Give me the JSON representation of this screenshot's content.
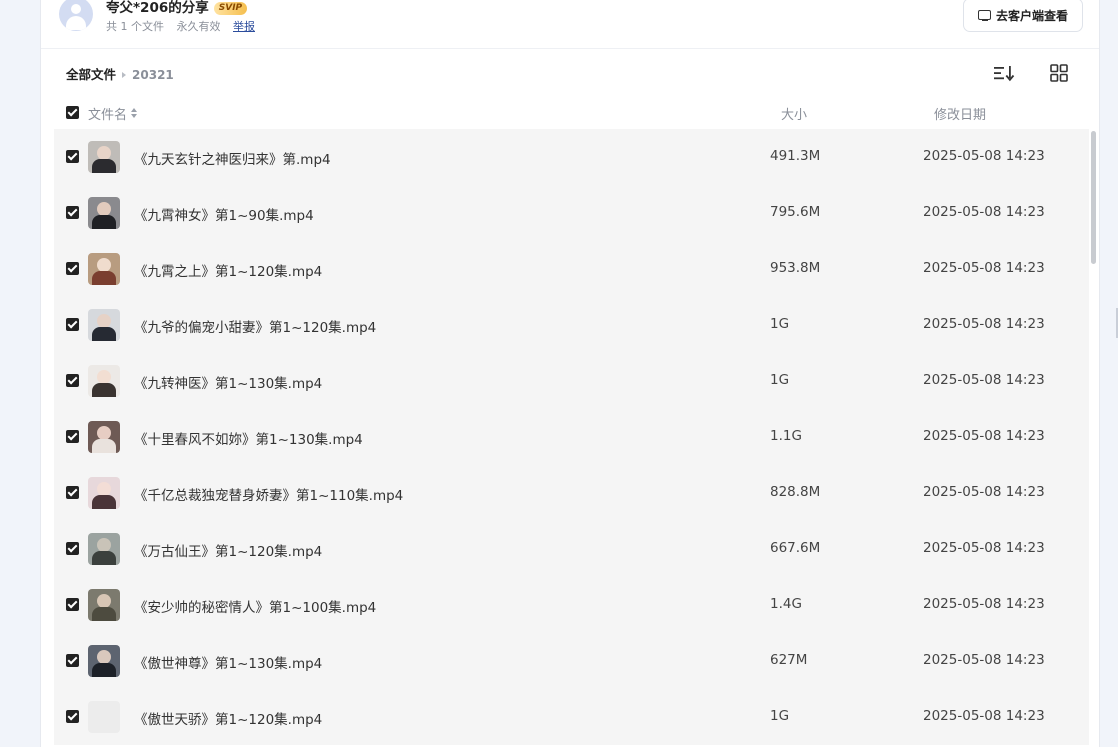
{
  "header": {
    "owner": "夸父*206的分享",
    "badge": "SVIP",
    "file_count": "共 1 个文件",
    "validity": "永久有效",
    "report": "举报",
    "client_button": "去客户端查看"
  },
  "breadcrumb": {
    "root": "全部文件",
    "current": "20321"
  },
  "table": {
    "col_name": "文件名",
    "col_size": "大小",
    "col_date": "修改日期"
  },
  "files": [
    {
      "name": "《九天玄针之神医归来》第.mp4",
      "size": "491.3M",
      "date": "2025-05-08 14:23"
    },
    {
      "name": "《九霄神女》第1~90集.mp4",
      "size": "795.6M",
      "date": "2025-05-08 14:23"
    },
    {
      "name": "《九霄之上》第1~120集.mp4",
      "size": "953.8M",
      "date": "2025-05-08 14:23"
    },
    {
      "name": "《九爷的偏宠小甜妻》第1~120集.mp4",
      "size": "1G",
      "date": "2025-05-08 14:23"
    },
    {
      "name": "《九转神医》第1~130集.mp4",
      "size": "1G",
      "date": "2025-05-08 14:23"
    },
    {
      "name": "《十里春风不如妳》第1~130集.mp4",
      "size": "1.1G",
      "date": "2025-05-08 14:23"
    },
    {
      "name": "《千亿总裁独宠替身娇妻》第1~110集.mp4",
      "size": "828.8M",
      "date": "2025-05-08 14:23"
    },
    {
      "name": "《万古仙王》第1~120集.mp4",
      "size": "667.6M",
      "date": "2025-05-08 14:23"
    },
    {
      "name": "《安少帅的秘密情人》第1~100集.mp4",
      "size": "1.4G",
      "date": "2025-05-08 14:23"
    },
    {
      "name": "《傲世神尊》第1~130集.mp4",
      "size": "627M",
      "date": "2025-05-08 14:23"
    },
    {
      "name": "《傲世天骄》第1~120集.mp4",
      "size": "1G",
      "date": "2025-05-08 14:23"
    }
  ]
}
